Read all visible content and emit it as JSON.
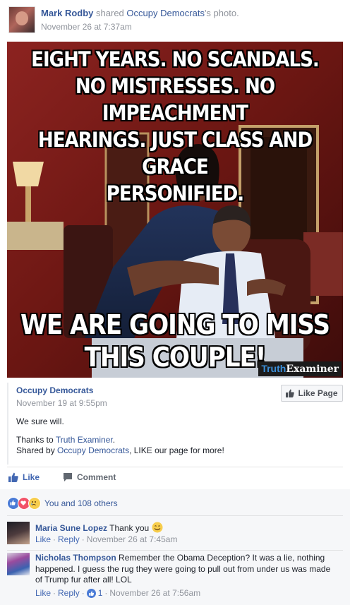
{
  "post": {
    "author": "Mark Rodby",
    "shared_text": "shared",
    "source_page": "Occupy Democrats",
    "possessive": "'s photo.",
    "timestamp": "November 26 at 7:37am"
  },
  "image": {
    "top_text": "EIGHT YEARS. NO SCANDALS. NO MISTRESSES. NO IMPEACHMENT HEARINGS. JUST CLASS AND GRACE PERSONIFIED.",
    "top_lines": [
      "EIGHT YEARS. NO SCANDALS.",
      "NO MISTRESSES. NO IMPEACHMENT",
      "HEARINGS. JUST CLASS AND GRACE",
      "PERSONIFIED."
    ],
    "bottom_lines": [
      "WE ARE GOING TO MISS",
      "THIS COUPLE!"
    ],
    "watermark_a": "Truth",
    "watermark_b": "Examiner"
  },
  "shared_post": {
    "page_name": "Occupy Democrats",
    "timestamp": "November 19 at 9:55pm",
    "like_page_label": "Like Page",
    "line1": "We sure will.",
    "thanks_prefix": "Thanks to ",
    "thanks_link": "Truth Examiner",
    "thanks_suffix": ".",
    "shared_by_prefix": "Shared by ",
    "shared_by_link": "Occupy Democrats",
    "shared_by_suffix": ", LIKE our page for more!"
  },
  "actions": {
    "like_label": "Like",
    "comment_label": "Comment"
  },
  "reactions": {
    "summary": "You and 108 others",
    "icons": [
      "like-reaction",
      "love-reaction",
      "sad-reaction"
    ]
  },
  "comments": [
    {
      "author": "Maria Sune Lopez",
      "text": "Thank you",
      "like_label": "Like",
      "reply_label": "Reply",
      "timestamp": "November 26 at 7:45am"
    },
    {
      "author": "Nicholas Thompson",
      "text": "Remember the Obama Deception? It was a lie, nothing happened. I guess the rug they were going to pull out from under us was made of Trump fur after all! LOL",
      "like_label": "Like",
      "reply_label": "Reply",
      "like_count": "1",
      "timestamp": "November 26 at 7:56am"
    }
  ],
  "colors": {
    "link": "#365899",
    "like_blue": "#4267b2",
    "meta_gray": "#90949c",
    "feedback_bg": "#f6f7f9"
  }
}
